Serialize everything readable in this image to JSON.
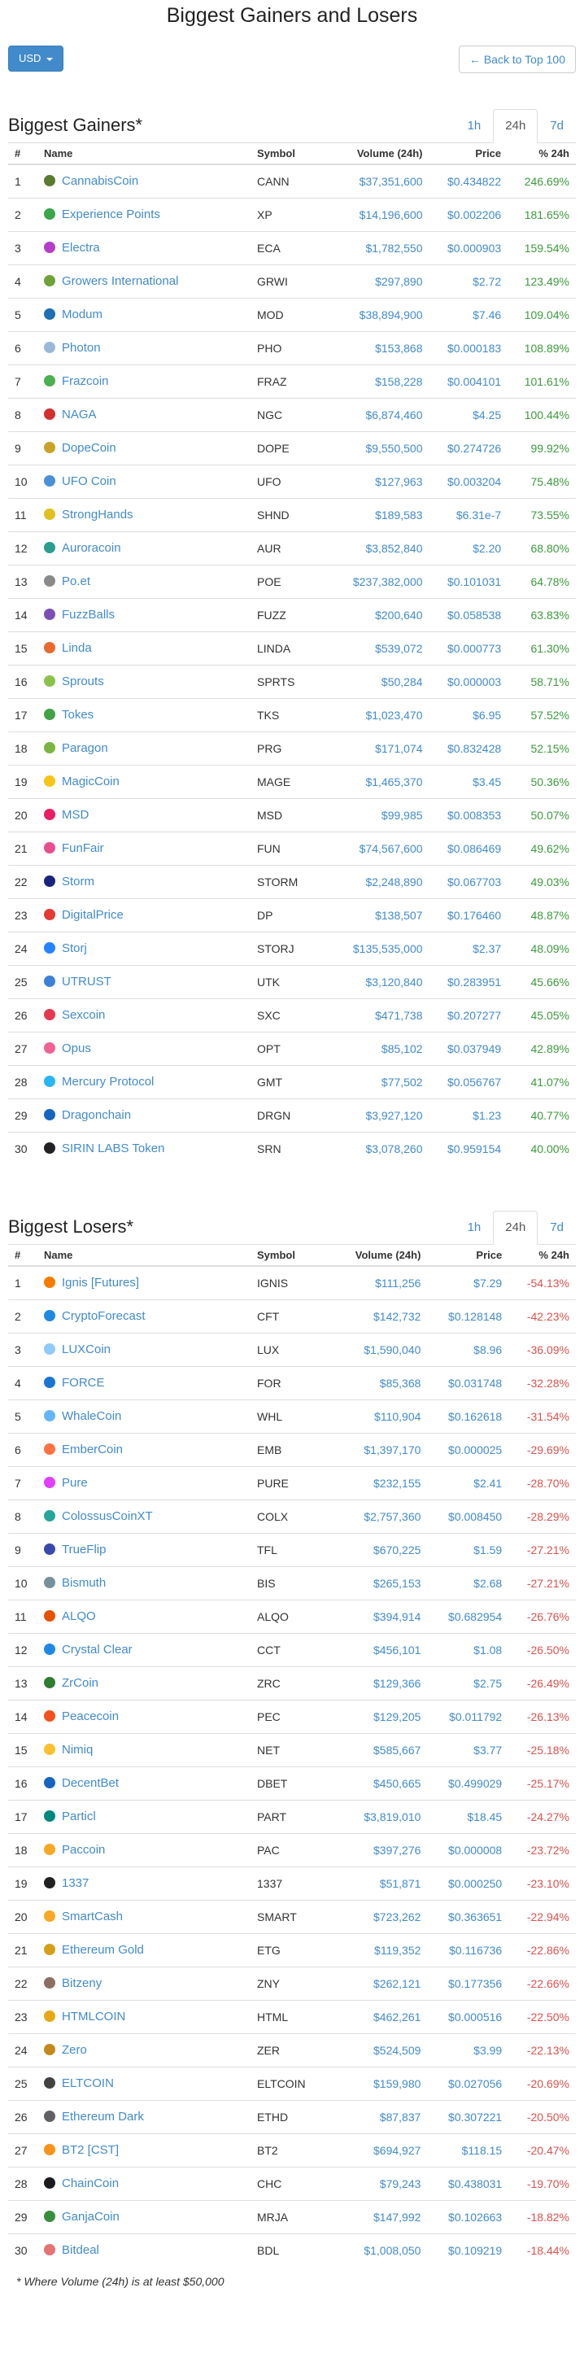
{
  "page": {
    "title": "Biggest Gainers and Losers",
    "currency_label": "USD",
    "back_label": "← Back to Top 100",
    "footnote": "* Where Volume (24h) is at least $50,000"
  },
  "columns": {
    "rank": "#",
    "name": "Name",
    "symbol": "Symbol",
    "volume": "Volume (24h)",
    "price": "Price",
    "change": "% 24h"
  },
  "tabs": [
    "1h",
    "24h",
    "7d"
  ],
  "gainers": {
    "title": "Biggest Gainers*",
    "rows": [
      {
        "rank": "1",
        "name": "CannabisCoin",
        "symbol": "CANN",
        "volume": "$37,351,600",
        "price": "$0.434822",
        "change": "246.69%",
        "color": "#5a7a2f"
      },
      {
        "rank": "2",
        "name": "Experience Points",
        "symbol": "XP",
        "volume": "$14,196,600",
        "price": "$0.002206",
        "change": "181.65%",
        "color": "#3aa54a"
      },
      {
        "rank": "3",
        "name": "Electra",
        "symbol": "ECA",
        "volume": "$1,782,550",
        "price": "$0.000903",
        "change": "159.54%",
        "color": "#b43ec9"
      },
      {
        "rank": "4",
        "name": "Growers International",
        "symbol": "GRWI",
        "volume": "$297,890",
        "price": "$2.72",
        "change": "123.49%",
        "color": "#6fa23a"
      },
      {
        "rank": "5",
        "name": "Modum",
        "symbol": "MOD",
        "volume": "$38,894,900",
        "price": "$7.46",
        "change": "109.04%",
        "color": "#1e6fb5"
      },
      {
        "rank": "6",
        "name": "Photon",
        "symbol": "PHO",
        "volume": "$153,868",
        "price": "$0.000183",
        "change": "108.89%",
        "color": "#9bb8d8"
      },
      {
        "rank": "7",
        "name": "Frazcoin",
        "symbol": "FRAZ",
        "volume": "$158,228",
        "price": "$0.004101",
        "change": "101.61%",
        "color": "#4caf50"
      },
      {
        "rank": "8",
        "name": "NAGA",
        "symbol": "NGC",
        "volume": "$6,874,460",
        "price": "$4.25",
        "change": "100.44%",
        "color": "#d32f2f"
      },
      {
        "rank": "9",
        "name": "DopeCoin",
        "symbol": "DOPE",
        "volume": "$9,550,500",
        "price": "$0.274726",
        "change": "99.92%",
        "color": "#c9a227"
      },
      {
        "rank": "10",
        "name": "UFO Coin",
        "symbol": "UFO",
        "volume": "$127,963",
        "price": "$0.003204",
        "change": "75.48%",
        "color": "#4a90d9"
      },
      {
        "rank": "11",
        "name": "StrongHands",
        "symbol": "SHND",
        "volume": "$189,583",
        "price": "$6.31e-7",
        "change": "73.55%",
        "color": "#e0c020"
      },
      {
        "rank": "12",
        "name": "Auroracoin",
        "symbol": "AUR",
        "volume": "$3,852,840",
        "price": "$2.20",
        "change": "68.80%",
        "color": "#2a9d8f"
      },
      {
        "rank": "13",
        "name": "Po.et",
        "symbol": "POE",
        "volume": "$237,382,000",
        "price": "$0.101031",
        "change": "64.78%",
        "color": "#8a8a8a"
      },
      {
        "rank": "14",
        "name": "FuzzBalls",
        "symbol": "FUZZ",
        "volume": "$200,640",
        "price": "$0.058538",
        "change": "63.83%",
        "color": "#7b4fb5"
      },
      {
        "rank": "15",
        "name": "Linda",
        "symbol": "LINDA",
        "volume": "$539,072",
        "price": "$0.000773",
        "change": "61.30%",
        "color": "#e86a2c"
      },
      {
        "rank": "16",
        "name": "Sprouts",
        "symbol": "SPRTS",
        "volume": "$50,284",
        "price": "$0.000003",
        "change": "58.71%",
        "color": "#8bc34a"
      },
      {
        "rank": "17",
        "name": "Tokes",
        "symbol": "TKS",
        "volume": "$1,023,470",
        "price": "$6.95",
        "change": "57.52%",
        "color": "#43a047"
      },
      {
        "rank": "18",
        "name": "Paragon",
        "symbol": "PRG",
        "volume": "$171,074",
        "price": "$0.832428",
        "change": "52.15%",
        "color": "#7cb342"
      },
      {
        "rank": "19",
        "name": "MagicCoin",
        "symbol": "MAGE",
        "volume": "$1,465,370",
        "price": "$3.45",
        "change": "50.36%",
        "color": "#f5c518"
      },
      {
        "rank": "20",
        "name": "MSD",
        "symbol": "MSD",
        "volume": "$99,985",
        "price": "$0.008353",
        "change": "50.07%",
        "color": "#e91e63"
      },
      {
        "rank": "21",
        "name": "FunFair",
        "symbol": "FUN",
        "volume": "$74,567,600",
        "price": "$0.086469",
        "change": "49.62%",
        "color": "#e94d8b"
      },
      {
        "rank": "22",
        "name": "Storm",
        "symbol": "STORM",
        "volume": "$2,248,890",
        "price": "$0.067703",
        "change": "49.03%",
        "color": "#1a237e"
      },
      {
        "rank": "23",
        "name": "DigitalPrice",
        "symbol": "DP",
        "volume": "$138,507",
        "price": "$0.176460",
        "change": "48.87%",
        "color": "#e53935"
      },
      {
        "rank": "24",
        "name": "Storj",
        "symbol": "STORJ",
        "volume": "$135,535,000",
        "price": "$2.37",
        "change": "48.09%",
        "color": "#2683ff"
      },
      {
        "rank": "25",
        "name": "UTRUST",
        "symbol": "UTK",
        "volume": "$3,120,840",
        "price": "$0.283951",
        "change": "45.66%",
        "color": "#3d7fd9"
      },
      {
        "rank": "26",
        "name": "Sexcoin",
        "symbol": "SXC",
        "volume": "$471,738",
        "price": "$0.207277",
        "change": "45.05%",
        "color": "#e53950"
      },
      {
        "rank": "27",
        "name": "Opus",
        "symbol": "OPT",
        "volume": "$85,102",
        "price": "$0.037949",
        "change": "42.89%",
        "color": "#f06292"
      },
      {
        "rank": "28",
        "name": "Mercury Protocol",
        "symbol": "GMT",
        "volume": "$77,502",
        "price": "$0.056767",
        "change": "41.07%",
        "color": "#29b6f6"
      },
      {
        "rank": "29",
        "name": "Dragonchain",
        "symbol": "DRGN",
        "volume": "$3,927,120",
        "price": "$1.23",
        "change": "40.77%",
        "color": "#1565c0"
      },
      {
        "rank": "30",
        "name": "SIRIN LABS Token",
        "symbol": "SRN",
        "volume": "$3,078,260",
        "price": "$0.959154",
        "change": "40.00%",
        "color": "#222222"
      }
    ]
  },
  "losers": {
    "title": "Biggest Losers*",
    "rows": [
      {
        "rank": "1",
        "name": "Ignis [Futures]",
        "symbol": "IGNIS",
        "volume": "$111,256",
        "price": "$7.29",
        "change": "-54.13%",
        "color": "#f57c00"
      },
      {
        "rank": "2",
        "name": "CryptoForecast",
        "symbol": "CFT",
        "volume": "$142,732",
        "price": "$0.128148",
        "change": "-42.23%",
        "color": "#1e88e5"
      },
      {
        "rank": "3",
        "name": "LUXCoin",
        "symbol": "LUX",
        "volume": "$1,590,040",
        "price": "$8.96",
        "change": "-36.09%",
        "color": "#90caf9"
      },
      {
        "rank": "4",
        "name": "FORCE",
        "symbol": "FOR",
        "volume": "$85,368",
        "price": "$0.031748",
        "change": "-32.28%",
        "color": "#1976d2"
      },
      {
        "rank": "5",
        "name": "WhaleCoin",
        "symbol": "WHL",
        "volume": "$110,904",
        "price": "$0.162618",
        "change": "-31.54%",
        "color": "#64b5f6"
      },
      {
        "rank": "6",
        "name": "EmberCoin",
        "symbol": "EMB",
        "volume": "$1,397,170",
        "price": "$0.000025",
        "change": "-29.69%",
        "color": "#ff7043"
      },
      {
        "rank": "7",
        "name": "Pure",
        "symbol": "PURE",
        "volume": "$232,155",
        "price": "$2.41",
        "change": "-28.70%",
        "color": "#e040fb"
      },
      {
        "rank": "8",
        "name": "ColossusCoinXT",
        "symbol": "COLX",
        "volume": "$2,757,360",
        "price": "$0.008450",
        "change": "-28.29%",
        "color": "#26a69a"
      },
      {
        "rank": "9",
        "name": "TrueFlip",
        "symbol": "TFL",
        "volume": "$670,225",
        "price": "$1.59",
        "change": "-27.21%",
        "color": "#3949ab"
      },
      {
        "rank": "10",
        "name": "Bismuth",
        "symbol": "BIS",
        "volume": "$265,153",
        "price": "$2.68",
        "change": "-27.21%",
        "color": "#78909c"
      },
      {
        "rank": "11",
        "name": "ALQO",
        "symbol": "ALQO",
        "volume": "$394,914",
        "price": "$0.682954",
        "change": "-26.76%",
        "color": "#e65100"
      },
      {
        "rank": "12",
        "name": "Crystal Clear",
        "symbol": "CCT",
        "volume": "$456,101",
        "price": "$1.08",
        "change": "-26.50%",
        "color": "#1e88e5"
      },
      {
        "rank": "13",
        "name": "ZrCoin",
        "symbol": "ZRC",
        "volume": "$129,366",
        "price": "$2.75",
        "change": "-26.49%",
        "color": "#2e7d32"
      },
      {
        "rank": "14",
        "name": "Peacecoin",
        "symbol": "PEC",
        "volume": "$129,205",
        "price": "$0.011792",
        "change": "-26.13%",
        "color": "#f4511e"
      },
      {
        "rank": "15",
        "name": "Nimiq",
        "symbol": "NET",
        "volume": "$585,667",
        "price": "$3.77",
        "change": "-25.18%",
        "color": "#fbc02d"
      },
      {
        "rank": "16",
        "name": "DecentBet",
        "symbol": "DBET",
        "volume": "$450,665",
        "price": "$0.499029",
        "change": "-25.17%",
        "color": "#1565c0"
      },
      {
        "rank": "17",
        "name": "Particl",
        "symbol": "PART",
        "volume": "$3,819,010",
        "price": "$18.45",
        "change": "-24.27%",
        "color": "#00897b"
      },
      {
        "rank": "18",
        "name": "Paccoin",
        "symbol": "PAC",
        "volume": "$397,276",
        "price": "$0.000008",
        "change": "-23.72%",
        "color": "#f9a825"
      },
      {
        "rank": "19",
        "name": "1337",
        "symbol": "1337",
        "volume": "$51,871",
        "price": "$0.000250",
        "change": "-23.10%",
        "color": "#212121"
      },
      {
        "rank": "20",
        "name": "SmartCash",
        "symbol": "SMART",
        "volume": "$723,262",
        "price": "$0.363651",
        "change": "-22.94%",
        "color": "#f9a825"
      },
      {
        "rank": "21",
        "name": "Ethereum Gold",
        "symbol": "ETG",
        "volume": "$119,352",
        "price": "$0.116736",
        "change": "-22.86%",
        "color": "#d4a017"
      },
      {
        "rank": "22",
        "name": "Bitzeny",
        "symbol": "ZNY",
        "volume": "$262,121",
        "price": "$0.177356",
        "change": "-22.66%",
        "color": "#8d6e63"
      },
      {
        "rank": "23",
        "name": "HTMLCOIN",
        "symbol": "HTML",
        "volume": "$462,261",
        "price": "$0.000516",
        "change": "-22.50%",
        "color": "#e6a817"
      },
      {
        "rank": "24",
        "name": "Zero",
        "symbol": "ZER",
        "volume": "$524,509",
        "price": "$3.99",
        "change": "-22.13%",
        "color": "#c28a1a"
      },
      {
        "rank": "25",
        "name": "ELTCOIN",
        "symbol": "ELTCOIN",
        "volume": "$159,980",
        "price": "$0.027056",
        "change": "-20.69%",
        "color": "#424242"
      },
      {
        "rank": "26",
        "name": "Ethereum Dark",
        "symbol": "ETHD",
        "volume": "$87,837",
        "price": "$0.307221",
        "change": "-20.50%",
        "color": "#616161"
      },
      {
        "rank": "27",
        "name": "BT2 [CST]",
        "symbol": "BT2",
        "volume": "$694,927",
        "price": "$118.15",
        "change": "-20.47%",
        "color": "#f7931a"
      },
      {
        "rank": "28",
        "name": "ChainCoin",
        "symbol": "CHC",
        "volume": "$79,243",
        "price": "$0.438031",
        "change": "-19.70%",
        "color": "#1c1c1c"
      },
      {
        "rank": "29",
        "name": "GanjaCoin",
        "symbol": "MRJA",
        "volume": "$147,992",
        "price": "$0.102663",
        "change": "-18.82%",
        "color": "#388e3c"
      },
      {
        "rank": "30",
        "name": "Bitdeal",
        "symbol": "BDL",
        "volume": "$1,008,050",
        "price": "$0.109219",
        "change": "-18.44%",
        "color": "#e57373"
      }
    ]
  }
}
